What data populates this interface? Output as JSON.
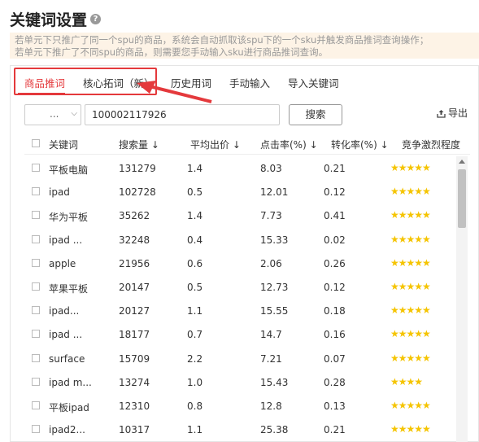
{
  "page": {
    "title": "关键词设置",
    "help_icon": "question-circle-icon"
  },
  "notice": {
    "line1": "若单元下只推广了同一个spu的商品，系统会自动抓取该spu下的一个sku并触发商品推词查询操作；",
    "line2": "若单元下推广了不同spu的商品，则需要您手动输入sku进行商品推词查询。"
  },
  "tabs": [
    {
      "label": "商品推词",
      "active": true
    },
    {
      "label": "核心拓词（新）",
      "active": false
    },
    {
      "label": "历史用词",
      "active": false
    },
    {
      "label": "手动输入",
      "active": false
    },
    {
      "label": "导入关键词",
      "active": false
    }
  ],
  "search": {
    "select_value": "...",
    "sku_value": "100002117926",
    "button_label": "搜索",
    "export_label": "导出"
  },
  "colors": {
    "accent": "#e4393c",
    "star": "#f5c400",
    "notice_bg": "#fdf3e6"
  },
  "table": {
    "headers": {
      "keyword": "关键词",
      "search_volume": "搜索量 ↓",
      "avg_bid": "平均出价 ↓",
      "ctr": "点击率(%) ↓",
      "cvr": "转化率(%) ↓",
      "competition": "竞争激烈程度"
    },
    "rows": [
      {
        "keyword": "平板电脑",
        "search_volume": "131279",
        "avg_bid": "1.4",
        "ctr": "8.03",
        "cvr": "0.21",
        "stars": "★★★★★",
        "star_count": 5
      },
      {
        "keyword": "ipad",
        "search_volume": "102728",
        "avg_bid": "0.5",
        "ctr": "12.01",
        "cvr": "0.12",
        "stars": "★★★★★",
        "star_count": 5
      },
      {
        "keyword": "华为平板",
        "search_volume": "35262",
        "avg_bid": "1.4",
        "ctr": "7.73",
        "cvr": "0.41",
        "stars": "★★★★★",
        "star_count": 5
      },
      {
        "keyword": "ipad ...",
        "search_volume": "32248",
        "avg_bid": "0.4",
        "ctr": "15.33",
        "cvr": "0.02",
        "stars": "★★★★★",
        "star_count": 5
      },
      {
        "keyword": "apple",
        "search_volume": "21956",
        "avg_bid": "0.6",
        "ctr": "2.06",
        "cvr": "0.26",
        "stars": "★★★★★",
        "star_count": 5
      },
      {
        "keyword": "苹果平板",
        "search_volume": "20147",
        "avg_bid": "0.5",
        "ctr": "12.73",
        "cvr": "0.12",
        "stars": "★★★★★",
        "star_count": 5
      },
      {
        "keyword": "ipad...",
        "search_volume": "20127",
        "avg_bid": "1.1",
        "ctr": "15.55",
        "cvr": "0.18",
        "stars": "★★★★★",
        "star_count": 5
      },
      {
        "keyword": "ipad ...",
        "search_volume": "18177",
        "avg_bid": "0.7",
        "ctr": "14.7",
        "cvr": "0.16",
        "stars": "★★★★★",
        "star_count": 5
      },
      {
        "keyword": "surface",
        "search_volume": "15709",
        "avg_bid": "2.2",
        "ctr": "7.21",
        "cvr": "0.07",
        "stars": "★★★★★",
        "star_count": 5
      },
      {
        "keyword": "ipad m...",
        "search_volume": "13274",
        "avg_bid": "1.0",
        "ctr": "15.43",
        "cvr": "0.28",
        "stars": "★★★★",
        "star_count": 4
      },
      {
        "keyword": "平板ipad",
        "search_volume": "12310",
        "avg_bid": "0.8",
        "ctr": "12.8",
        "cvr": "0.13",
        "stars": "★★★★★",
        "star_count": 5
      },
      {
        "keyword": "ipad2...",
        "search_volume": "10317",
        "avg_bid": "1.1",
        "ctr": "25.38",
        "cvr": "0.21",
        "stars": "★★★★★",
        "star_count": 5
      }
    ]
  }
}
